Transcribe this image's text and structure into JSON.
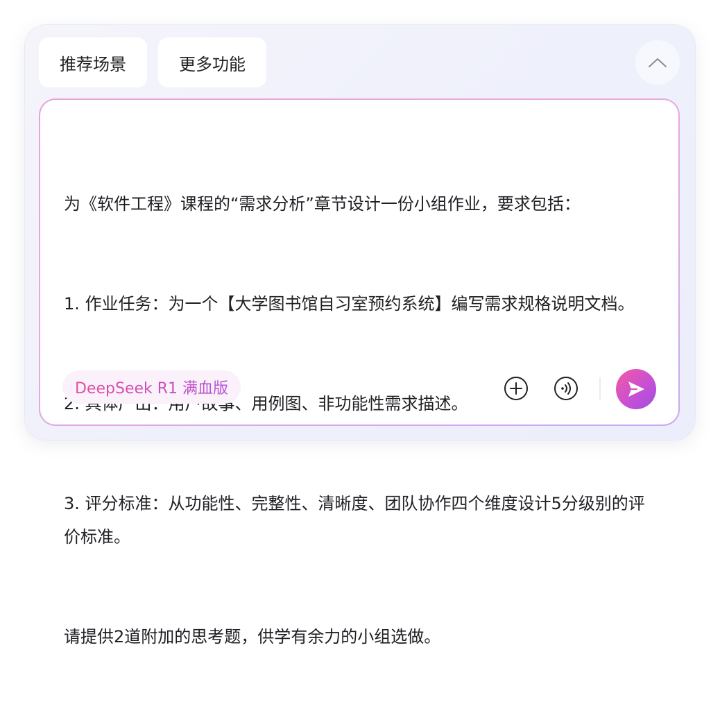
{
  "chips": {
    "recommended_scenes": "推荐场景",
    "more_features": "更多功能"
  },
  "prompt": {
    "lines": [
      "为《软件工程》课程的“需求分析”章节设计一份小组作业，要求包括：",
      "1. 作业任务：为一个【大学图书馆自习室预约系统】编写需求规格说明文档。",
      "2. 具体产出：用户故事、用例图、非功能性需求描述。",
      "3. 评分标准：从功能性、完整性、清晰度、团队协作四个维度设计5分级别的评价标准。",
      "请提供2道附加的思考题，供学有余力的小组选做。"
    ]
  },
  "model": {
    "label": "DeepSeek R1 满血版"
  },
  "icons": {
    "collapse": "chevron-up-icon",
    "add": "plus-circle-icon",
    "voice": "voice-input-icon",
    "send": "send-icon"
  },
  "colors": {
    "accent_pink": "#f45aa2",
    "accent_purple": "#9f4fe0",
    "border_gradient_start": "#e6a3d8",
    "border_gradient_end": "#c9a8ee"
  }
}
